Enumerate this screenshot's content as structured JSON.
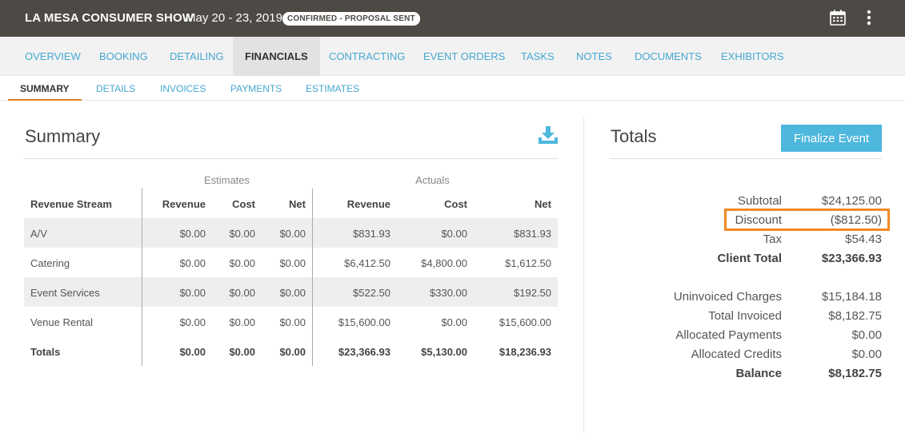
{
  "header": {
    "event_name": "LA MESA CONSUMER SHOW",
    "dates": "May 20 - 23, 2019",
    "status": "CONFIRMED - PROPOSAL SENT",
    "icons": [
      "calendar-icon",
      "more-vertical-icon"
    ]
  },
  "main_nav": {
    "tabs": [
      "OVERVIEW",
      "BOOKING",
      "DETAILING",
      "FINANCIALS",
      "CONTRACTING",
      "EVENT ORDERS",
      "TASKS",
      "NOTES",
      "DOCUMENTS",
      "EXHIBITORS"
    ],
    "active": "FINANCIALS"
  },
  "sub_nav": {
    "tabs": [
      "SUMMARY",
      "DETAILS",
      "INVOICES",
      "PAYMENTS",
      "ESTIMATES"
    ],
    "active": "SUMMARY"
  },
  "summary": {
    "title": "Summary",
    "group_estimates": "Estimates",
    "group_actuals": "Actuals",
    "columns": [
      "Revenue Stream",
      "Revenue",
      "Cost",
      "Net",
      "Revenue",
      "Cost",
      "Net"
    ],
    "rows": [
      {
        "name": "A/V",
        "est": [
          "$0.00",
          "$0.00",
          "$0.00"
        ],
        "act": [
          "$831.93",
          "$0.00",
          "$831.93"
        ]
      },
      {
        "name": "Catering",
        "est": [
          "$0.00",
          "$0.00",
          "$0.00"
        ],
        "act": [
          "$6,412.50",
          "$4,800.00",
          "$1,612.50"
        ]
      },
      {
        "name": "Event Services",
        "est": [
          "$0.00",
          "$0.00",
          "$0.00"
        ],
        "act": [
          "$522.50",
          "$330.00",
          "$192.50"
        ]
      },
      {
        "name": "Venue Rental",
        "est": [
          "$0.00",
          "$0.00",
          "$0.00"
        ],
        "act": [
          "$15,600.00",
          "$0.00",
          "$15,600.00"
        ]
      }
    ],
    "totals": {
      "name": "Totals",
      "est": [
        "$0.00",
        "$0.00",
        "$0.00"
      ],
      "act": [
        "$23,366.93",
        "$5,130.00",
        "$18,236.93"
      ]
    }
  },
  "totals": {
    "title": "Totals",
    "finalize_label": "Finalize Event",
    "subtotal_label": "Subtotal",
    "subtotal": "$24,125.00",
    "discount_label": "Discount",
    "discount": "($812.50)",
    "tax_label": "Tax",
    "tax": "$54.43",
    "client_total_label": "Client Total",
    "client_total": "$23,366.93",
    "uninvoiced_label": "Uninvoiced Charges",
    "uninvoiced": "$15,184.18",
    "total_invoiced_label": "Total Invoiced",
    "total_invoiced": "$8,182.75",
    "allocated_payments_label": "Allocated Payments",
    "allocated_payments": "$0.00",
    "allocated_credits_label": "Allocated Credits",
    "allocated_credits": "$0.00",
    "balance_label": "Balance",
    "balance": "$8,182.75"
  },
  "colors": {
    "header_bg": "#4d4a45",
    "link": "#46a7d0",
    "accent": "#e07b1f",
    "button": "#4db7dd",
    "highlight": "#f08a24"
  }
}
